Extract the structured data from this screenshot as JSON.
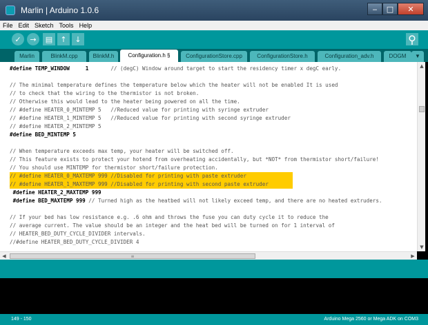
{
  "window": {
    "title": "Marlin | Arduino 1.0.6",
    "minimize_glyph": "‒",
    "maximize_glyph": "□",
    "close_glyph": "✕"
  },
  "menu": [
    "File",
    "Edit",
    "Sketch",
    "Tools",
    "Help"
  ],
  "toolbar": {
    "verify_icon": "check-icon",
    "upload_icon": "arrow-right-icon",
    "new_icon": "new-file-icon",
    "open_icon": "open-icon",
    "save_icon": "save-icon",
    "serial_icon": "magnifier-icon",
    "glyphs": {
      "verify": "✓",
      "upload": "→",
      "new": "▤",
      "open": "↑",
      "save": "↓",
      "serial": "⚲"
    }
  },
  "tabs": [
    {
      "label": "Marlin"
    },
    {
      "label": "BlinkM.cpp"
    },
    {
      "label": "BlinkM.h"
    },
    {
      "label": "Configuration.h §",
      "active": true
    },
    {
      "label": "ConfigurationStore.cpp"
    },
    {
      "label": "ConfigurationStore.h"
    },
    {
      "label": "Configuration_adv.h"
    },
    {
      "label": "DOGM"
    },
    {
      "label": "▼"
    }
  ],
  "editor": {
    "lines": [
      {
        "text": "#define TEMP_WINDOW     1       // (degC) Window around target to start the residency timer x degC early.",
        "kind": "mixed"
      },
      {
        "text": "",
        "kind": "comment"
      },
      {
        "text": "// The minimal temperature defines the temperature below which the heater will not be enabled It is used",
        "kind": "comment"
      },
      {
        "text": "// to check that the wiring to the thermistor is not broken.",
        "kind": "comment"
      },
      {
        "text": "// Otherwise this would lead to the heater being powered on all the time.",
        "kind": "comment"
      },
      {
        "text": "// #define HEATER_0_MINTEMP 5   //Reduced value for printing with syringe extruder",
        "kind": "comment"
      },
      {
        "text": "// #define HEATER_1_MINTEMP 5   //Reduced value for printing with second syringe extruder",
        "kind": "comment"
      },
      {
        "text": "// #define HEATER_2_MINTEMP 5",
        "kind": "comment"
      },
      {
        "text": "#define BED_MINTEMP 5",
        "kind": "code"
      },
      {
        "text": "",
        "kind": "comment"
      },
      {
        "text": "// When temperature exceeds max temp, your heater will be switched off.",
        "kind": "comment"
      },
      {
        "text": "// This feature exists to protect your hotend from overheating accidentally, but *NOT* from thermistor short/failure!",
        "kind": "comment"
      },
      {
        "text": "// You should use MINTEMP for thermistor short/failure protection.",
        "kind": "comment"
      },
      {
        "text": "// #define HEATER_0_MAXTEMP 999 //Disabled for printing with paste extruder",
        "kind": "highlight"
      },
      {
        "text": "// #define HEATER_1_MAXTEMP 999 //Disabled for printing with second paste extruder",
        "kind": "highlight"
      },
      {
        "text": " #define HEATER_2_MAXTEMP 999",
        "kind": "code"
      },
      {
        "text": " #define BED_MAXTEMP 999 // Turned high as the heatbed will not likely exceed temp, and there are no heated extruders.",
        "kind": "mixed"
      },
      {
        "text": "",
        "kind": "comment"
      },
      {
        "text": "// If your bed has low resistance e.g. .6 ohm and throws the fuse you can duty cycle it to reduce the",
        "kind": "comment"
      },
      {
        "text": "// average current. The value should be an integer and the heat bed will be turned on for 1 interval of",
        "kind": "comment"
      },
      {
        "text": "// HEATER_BED_DUTY_CYCLE_DIVIDER intervals.",
        "kind": "comment"
      },
      {
        "text": "//#define HEATER_BED_DUTY_CYCLE_DIVIDER 4",
        "kind": "comment"
      }
    ]
  },
  "scroll": {
    "up_glyph": "▲",
    "down_glyph": "▼",
    "left_glyph": "◀",
    "right_glyph": "▶",
    "grip_glyph": "≡"
  },
  "status": {
    "line_range": "149 - 150",
    "board": "Arduino Mega 2560 or Mega ADK on COM3"
  }
}
